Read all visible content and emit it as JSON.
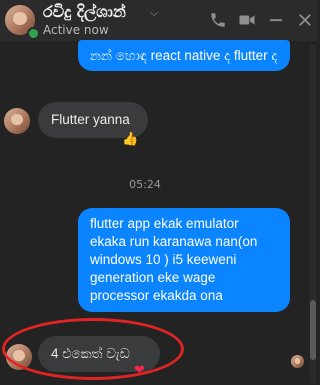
{
  "header": {
    "name": "රවිදු දිල්ශාන්",
    "status": "Active now",
    "icons": [
      "phone-icon",
      "video-camera-icon",
      "minimize-icon",
      "close-icon"
    ]
  },
  "messages": {
    "out_1": "නන් හොඳ react native ද flutter ද",
    "in_1": "Flutter yanna",
    "in_1_reaction": "👍",
    "timestamp": "05:24",
    "out_2": "flutter app ekak emulator ekaka run karanawa nan(on windows 10 ) i5 keeweni generation eke wage processor ekakda ona",
    "in_2": "4 එකෙත් වැඩ",
    "in_2_reaction": "❤"
  },
  "colors": {
    "background": "#232323",
    "outgoing": "#0a84ff",
    "incoming": "#3a3b3c",
    "online": "#31a24c",
    "highlight_circle": "#e02424"
  }
}
